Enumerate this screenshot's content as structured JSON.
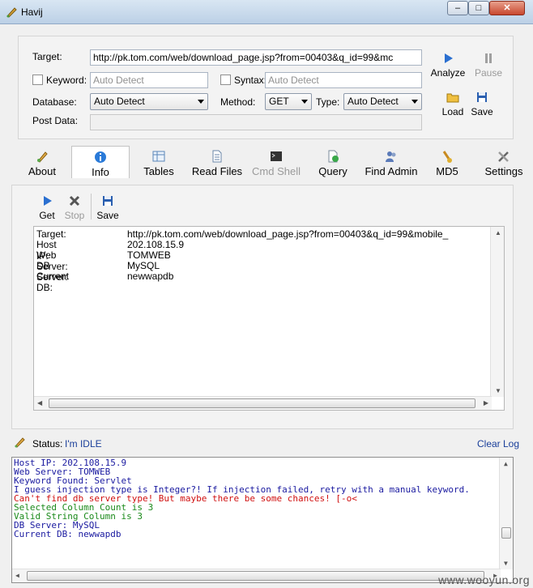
{
  "window": {
    "title": "Havij",
    "minimize": "–",
    "maximize": "□",
    "close": "✕"
  },
  "form": {
    "target_label": "Target:",
    "target_value": "http://pk.tom.com/web/download_page.jsp?from=00403&q_id=99&mc",
    "keyword_label": "Keyword:",
    "keyword_placeholder": "Auto Detect",
    "syntax_label": "Syntax:",
    "syntax_placeholder": "Auto Detect",
    "database_label": "Database:",
    "database_value": "Auto Detect",
    "method_label": "Method:",
    "method_value": "GET",
    "type_label": "Type:",
    "type_value": "Auto Detect",
    "postdata_label": "Post Data:",
    "postdata_value": ""
  },
  "actions": {
    "analyze": "Analyze",
    "pause": "Pause",
    "load": "Load",
    "save": "Save"
  },
  "tabs": [
    {
      "label": "About",
      "icon": "about-icon"
    },
    {
      "label": "Info",
      "icon": "info-icon"
    },
    {
      "label": "Tables",
      "icon": "tables-icon"
    },
    {
      "label": "Read Files",
      "icon": "read-files-icon"
    },
    {
      "label": "Cmd Shell",
      "icon": "cmd-shell-icon"
    },
    {
      "label": "Query",
      "icon": "query-icon"
    },
    {
      "label": "Find Admin",
      "icon": "find-admin-icon"
    },
    {
      "label": "MD5",
      "icon": "md5-icon"
    },
    {
      "label": "Settings",
      "icon": "settings-icon"
    }
  ],
  "info_toolbar": {
    "get": "Get",
    "stop": "Stop",
    "save": "Save"
  },
  "info_rows": [
    {
      "key": "Target:",
      "value": "http://pk.tom.com/web/download_page.jsp?from=00403&q_id=99&mobile_"
    },
    {
      "key": "Host IP:",
      "value": "202.108.15.9"
    },
    {
      "key": "Web Server:",
      "value": "TOMWEB"
    },
    {
      "key": "DB Server:",
      "value": "MySQL"
    },
    {
      "key": "Current DB:",
      "value": "newwapdb"
    }
  ],
  "status": {
    "label": "Status:",
    "value": "I'm IDLE",
    "clear_log": "Clear Log"
  },
  "log": [
    {
      "text": "Host IP: 202.108.15.9",
      "color": "#1a1aa0"
    },
    {
      "text": "Web Server: TOMWEB",
      "color": "#1a1aa0"
    },
    {
      "text": "Keyword Found: Servlet",
      "color": "#1a1aa0"
    },
    {
      "text": "I guess injection type is Integer?! If injection failed, retry with a manual keyword.",
      "color": "#1a1aa0"
    },
    {
      "text": "Can't find db server type! But maybe there be some chances! [-o<",
      "color": "#d01010"
    },
    {
      "text": "Selected Column Count is 3",
      "color": "#1a8a1a"
    },
    {
      "text": "Valid String Column is 3",
      "color": "#1a8a1a"
    },
    {
      "text": "DB Server: MySQL",
      "color": "#1a1aa0"
    },
    {
      "text": "Current DB: newwapdb",
      "color": "#1a1aa0"
    }
  ],
  "watermark": "www.wooyun.org"
}
